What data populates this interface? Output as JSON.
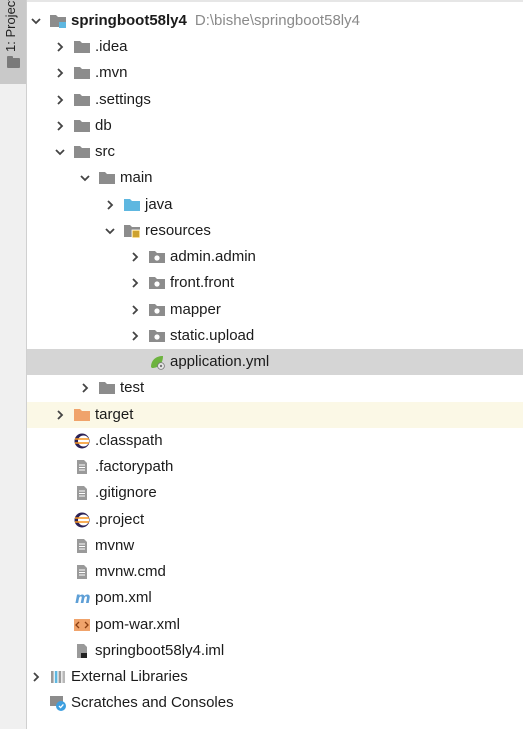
{
  "side_stripe": {
    "label": "1: Project"
  },
  "tree": {
    "root": {
      "name": "springboot58ly4",
      "path": "D:\\bishe\\springboot58ly4"
    },
    "items": [
      {
        "label": ".idea"
      },
      {
        "label": ".mvn"
      },
      {
        "label": ".settings"
      },
      {
        "label": "db"
      },
      {
        "label": "src"
      },
      {
        "label": "main"
      },
      {
        "label": "java"
      },
      {
        "label": "resources"
      },
      {
        "label": "admin.admin"
      },
      {
        "label": "front.front"
      },
      {
        "label": "mapper"
      },
      {
        "label": "static.upload"
      },
      {
        "label": "application.yml"
      },
      {
        "label": "test"
      },
      {
        "label": "target"
      },
      {
        "label": ".classpath"
      },
      {
        "label": ".factorypath"
      },
      {
        "label": ".gitignore"
      },
      {
        "label": ".project"
      },
      {
        "label": "mvnw"
      },
      {
        "label": "mvnw.cmd"
      },
      {
        "label": "pom.xml"
      },
      {
        "label": "pom-war.xml"
      },
      {
        "label": "springboot58ly4.iml"
      },
      {
        "label": "External Libraries"
      },
      {
        "label": "Scratches and Consoles"
      }
    ]
  },
  "icons": {
    "folder": "folder-icon",
    "java_source_folder": "java-source-folder-icon",
    "resources_folder": "resources-folder-icon",
    "package": "package-icon",
    "spring_config": "spring-yml-icon",
    "excluded_folder": "excluded-folder-icon",
    "eclipse": "eclipse-icon",
    "text_file": "text-file-icon",
    "maven": "maven-icon",
    "xml": "xml-icon",
    "iml": "iml-icon",
    "libraries": "libraries-icon",
    "scratches": "scratches-icon"
  },
  "colors": {
    "folder": "#8c8c8c",
    "java_source": "#5eb7e0",
    "excluded": "#f0a36b",
    "selected_row": "#d5d5d5",
    "path_text": "#8a8a8a"
  }
}
